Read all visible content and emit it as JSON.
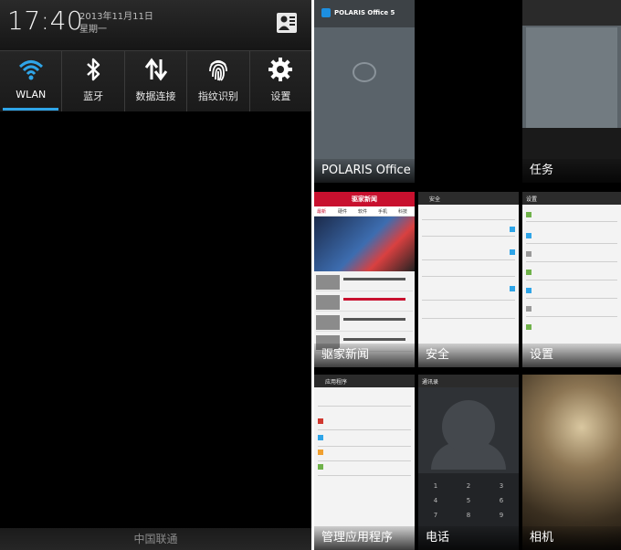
{
  "status_header": {
    "time": "17:40",
    "date": "2013年11月11日",
    "weekday": "星期一",
    "settings_icon": "user-settings-icon"
  },
  "quick_settings": [
    {
      "label": "WLAN",
      "icon": "wifi-icon",
      "active": true
    },
    {
      "label": "蓝牙",
      "icon": "bluetooth-icon",
      "active": false
    },
    {
      "label": "数据连接",
      "icon": "data-transfer-icon",
      "active": false
    },
    {
      "label": "指纹识别",
      "icon": "fingerprint-icon",
      "active": false
    },
    {
      "label": "设置",
      "icon": "gear-icon",
      "active": false
    }
  ],
  "carrier": "中国联通",
  "accent_color": "#2fa5e8",
  "recent_apps": {
    "polaris": {
      "label": "POLARIS Office 5",
      "header": "POLARIS Office 5"
    },
    "tasks": {
      "label": "任务"
    },
    "news": {
      "label": "驱家新闻",
      "header": "驱家新闻",
      "tabs": [
        "最新",
        "硬件",
        "软件",
        "手机",
        "科技"
      ]
    },
    "security": {
      "label": "安全",
      "header": "安全"
    },
    "settings": {
      "label": "设置",
      "header": "设置"
    },
    "apps": {
      "label": "管理应用程序",
      "header": "应用程序"
    },
    "phone": {
      "label": "电话",
      "header": "通讯录",
      "keys": [
        "1",
        "2",
        "3",
        "4",
        "5",
        "6",
        "7",
        "8",
        "9"
      ]
    },
    "camera": {
      "label": "相机"
    }
  }
}
